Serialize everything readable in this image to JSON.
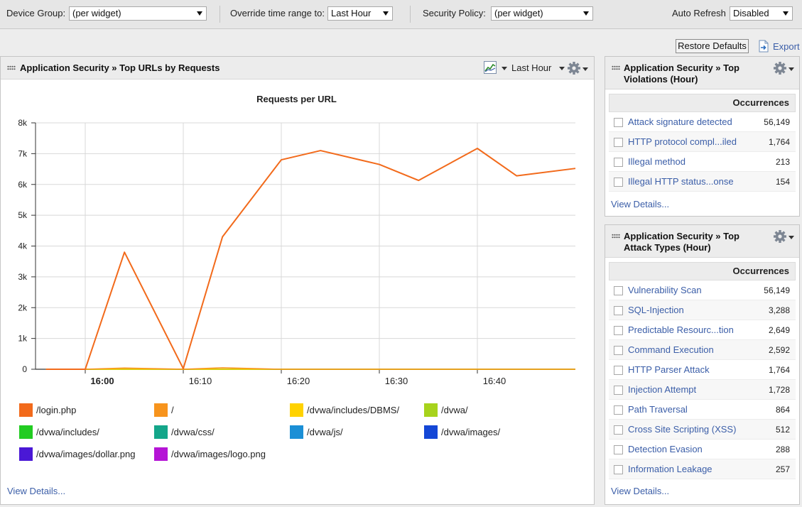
{
  "filters": {
    "device_group_label": "Device Group:",
    "device_group_value": "(per widget)",
    "override_label": "Override time range to:",
    "override_value": "Last Hour",
    "security_policy_label": "Security Policy:",
    "security_policy_value": "(per widget)",
    "auto_refresh_label": "Auto Refresh",
    "auto_refresh_value": "Disabled"
  },
  "actions": {
    "restore_defaults": "Restore Defaults",
    "export": "Export"
  },
  "main_panel": {
    "title": "Application Security » Top URLs by Requests",
    "time_range": "Last Hour",
    "view_details": "View Details..."
  },
  "chart_data": {
    "type": "line",
    "title": "Requests per URL",
    "xlabel": "",
    "ylabel": "",
    "x": [
      "15:56",
      "16:00",
      "16:04",
      "16:10",
      "16:14",
      "16:20",
      "16:24",
      "16:30",
      "16:34",
      "16:40",
      "16:44",
      "16:50"
    ],
    "x_ticks": [
      "16:00",
      "16:10",
      "16:20",
      "16:30",
      "16:40"
    ],
    "y_ticks": [
      "0",
      "1k",
      "2k",
      "3k",
      "4k",
      "5k",
      "6k",
      "7k",
      "8k"
    ],
    "ylim": [
      0,
      8000
    ],
    "grid": true,
    "legend_position": "bottom",
    "series": [
      {
        "name": "/login.php",
        "color": "#f26a1b",
        "values": [
          0,
          0,
          3800,
          20,
          4300,
          6800,
          7100,
          6650,
          6130,
          7170,
          6280,
          6520
        ]
      },
      {
        "name": "/",
        "color": "#f7941d",
        "values": [
          0,
          0,
          40,
          0,
          50,
          0,
          0,
          0,
          0,
          0,
          0,
          0
        ]
      },
      {
        "name": "/dvwa/includes/DBMS/",
        "color": "#ffd200",
        "values": [
          0,
          0,
          0,
          0,
          0,
          0,
          0,
          0,
          0,
          0,
          0,
          0
        ]
      },
      {
        "name": "/dvwa/",
        "color": "#a7d31c",
        "values": [
          0,
          0,
          0,
          0,
          0,
          0,
          0,
          0,
          0,
          0,
          0,
          0
        ]
      },
      {
        "name": "/dvwa/includes/",
        "color": "#22cc22",
        "values": [
          0,
          0,
          0,
          0,
          0,
          0,
          0,
          0,
          0,
          0,
          0,
          0
        ]
      },
      {
        "name": "/dvwa/css/",
        "color": "#14a68a",
        "values": [
          0,
          0,
          0,
          0,
          0,
          0,
          0,
          0,
          0,
          0,
          0,
          0
        ]
      },
      {
        "name": "/dvwa/js/",
        "color": "#1b8fd6",
        "values": [
          0,
          0,
          0,
          0,
          0,
          0,
          0,
          0,
          0,
          0,
          0,
          0
        ]
      },
      {
        "name": "/dvwa/images/",
        "color": "#1447d6",
        "values": [
          0,
          0,
          0,
          0,
          0,
          0,
          0,
          0,
          0,
          0,
          0,
          0
        ]
      },
      {
        "name": "/dvwa/images/dollar.png",
        "color": "#4a18d6",
        "values": [
          0,
          0,
          0,
          0,
          0,
          0,
          0,
          0,
          0,
          0,
          0,
          0
        ]
      },
      {
        "name": "/dvwa/images/logo.png",
        "color": "#b514d6",
        "values": [
          0,
          0,
          0,
          0,
          0,
          0,
          0,
          0,
          0,
          0,
          0,
          0
        ]
      }
    ]
  },
  "violations_panel": {
    "title_line1": "Application Security » Top",
    "title_line2": "Violations (Hour)",
    "column": "Occurrences",
    "rows": [
      {
        "name": "Attack signature detected",
        "count": "56,149"
      },
      {
        "name": "HTTP protocol compl...iled",
        "count": "1,764"
      },
      {
        "name": "Illegal method",
        "count": "213"
      },
      {
        "name": "Illegal HTTP status...onse",
        "count": "154"
      }
    ],
    "view_details": "View Details..."
  },
  "attack_panel": {
    "title_line1": "Application Security » Top",
    "title_line2": "Attack Types (Hour)",
    "column": "Occurrences",
    "rows": [
      {
        "name": "Vulnerability Scan",
        "count": "56,149"
      },
      {
        "name": "SQL-Injection",
        "count": "3,288"
      },
      {
        "name": "Predictable Resourc...tion",
        "count": "2,649"
      },
      {
        "name": "Command Execution",
        "count": "2,592"
      },
      {
        "name": "HTTP Parser Attack",
        "count": "1,764"
      },
      {
        "name": "Injection Attempt",
        "count": "1,728"
      },
      {
        "name": "Path Traversal",
        "count": "864"
      },
      {
        "name": "Cross Site Scripting (XSS)",
        "count": "512"
      },
      {
        "name": "Detection Evasion",
        "count": "288"
      },
      {
        "name": "Information Leakage",
        "count": "257"
      }
    ],
    "view_details": "View Details..."
  },
  "colors": {
    "link": "#3b5ea8",
    "panel_header": "#ececec",
    "line_primary": "#f26a1b"
  }
}
